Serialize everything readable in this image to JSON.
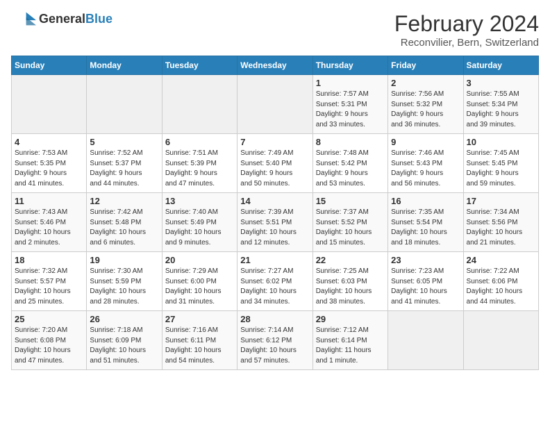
{
  "logo": {
    "general": "General",
    "blue": "Blue"
  },
  "header": {
    "month": "February 2024",
    "location": "Reconvilier, Bern, Switzerland"
  },
  "weekdays": [
    "Sunday",
    "Monday",
    "Tuesday",
    "Wednesday",
    "Thursday",
    "Friday",
    "Saturday"
  ],
  "weeks": [
    [
      {
        "day": "",
        "info": ""
      },
      {
        "day": "",
        "info": ""
      },
      {
        "day": "",
        "info": ""
      },
      {
        "day": "",
        "info": ""
      },
      {
        "day": "1",
        "info": "Sunrise: 7:57 AM\nSunset: 5:31 PM\nDaylight: 9 hours\nand 33 minutes."
      },
      {
        "day": "2",
        "info": "Sunrise: 7:56 AM\nSunset: 5:32 PM\nDaylight: 9 hours\nand 36 minutes."
      },
      {
        "day": "3",
        "info": "Sunrise: 7:55 AM\nSunset: 5:34 PM\nDaylight: 9 hours\nand 39 minutes."
      }
    ],
    [
      {
        "day": "4",
        "info": "Sunrise: 7:53 AM\nSunset: 5:35 PM\nDaylight: 9 hours\nand 41 minutes."
      },
      {
        "day": "5",
        "info": "Sunrise: 7:52 AM\nSunset: 5:37 PM\nDaylight: 9 hours\nand 44 minutes."
      },
      {
        "day": "6",
        "info": "Sunrise: 7:51 AM\nSunset: 5:39 PM\nDaylight: 9 hours\nand 47 minutes."
      },
      {
        "day": "7",
        "info": "Sunrise: 7:49 AM\nSunset: 5:40 PM\nDaylight: 9 hours\nand 50 minutes."
      },
      {
        "day": "8",
        "info": "Sunrise: 7:48 AM\nSunset: 5:42 PM\nDaylight: 9 hours\nand 53 minutes."
      },
      {
        "day": "9",
        "info": "Sunrise: 7:46 AM\nSunset: 5:43 PM\nDaylight: 9 hours\nand 56 minutes."
      },
      {
        "day": "10",
        "info": "Sunrise: 7:45 AM\nSunset: 5:45 PM\nDaylight: 9 hours\nand 59 minutes."
      }
    ],
    [
      {
        "day": "11",
        "info": "Sunrise: 7:43 AM\nSunset: 5:46 PM\nDaylight: 10 hours\nand 2 minutes."
      },
      {
        "day": "12",
        "info": "Sunrise: 7:42 AM\nSunset: 5:48 PM\nDaylight: 10 hours\nand 6 minutes."
      },
      {
        "day": "13",
        "info": "Sunrise: 7:40 AM\nSunset: 5:49 PM\nDaylight: 10 hours\nand 9 minutes."
      },
      {
        "day": "14",
        "info": "Sunrise: 7:39 AM\nSunset: 5:51 PM\nDaylight: 10 hours\nand 12 minutes."
      },
      {
        "day": "15",
        "info": "Sunrise: 7:37 AM\nSunset: 5:52 PM\nDaylight: 10 hours\nand 15 minutes."
      },
      {
        "day": "16",
        "info": "Sunrise: 7:35 AM\nSunset: 5:54 PM\nDaylight: 10 hours\nand 18 minutes."
      },
      {
        "day": "17",
        "info": "Sunrise: 7:34 AM\nSunset: 5:56 PM\nDaylight: 10 hours\nand 21 minutes."
      }
    ],
    [
      {
        "day": "18",
        "info": "Sunrise: 7:32 AM\nSunset: 5:57 PM\nDaylight: 10 hours\nand 25 minutes."
      },
      {
        "day": "19",
        "info": "Sunrise: 7:30 AM\nSunset: 5:59 PM\nDaylight: 10 hours\nand 28 minutes."
      },
      {
        "day": "20",
        "info": "Sunrise: 7:29 AM\nSunset: 6:00 PM\nDaylight: 10 hours\nand 31 minutes."
      },
      {
        "day": "21",
        "info": "Sunrise: 7:27 AM\nSunset: 6:02 PM\nDaylight: 10 hours\nand 34 minutes."
      },
      {
        "day": "22",
        "info": "Sunrise: 7:25 AM\nSunset: 6:03 PM\nDaylight: 10 hours\nand 38 minutes."
      },
      {
        "day": "23",
        "info": "Sunrise: 7:23 AM\nSunset: 6:05 PM\nDaylight: 10 hours\nand 41 minutes."
      },
      {
        "day": "24",
        "info": "Sunrise: 7:22 AM\nSunset: 6:06 PM\nDaylight: 10 hours\nand 44 minutes."
      }
    ],
    [
      {
        "day": "25",
        "info": "Sunrise: 7:20 AM\nSunset: 6:08 PM\nDaylight: 10 hours\nand 47 minutes."
      },
      {
        "day": "26",
        "info": "Sunrise: 7:18 AM\nSunset: 6:09 PM\nDaylight: 10 hours\nand 51 minutes."
      },
      {
        "day": "27",
        "info": "Sunrise: 7:16 AM\nSunset: 6:11 PM\nDaylight: 10 hours\nand 54 minutes."
      },
      {
        "day": "28",
        "info": "Sunrise: 7:14 AM\nSunset: 6:12 PM\nDaylight: 10 hours\nand 57 minutes."
      },
      {
        "day": "29",
        "info": "Sunrise: 7:12 AM\nSunset: 6:14 PM\nDaylight: 11 hours\nand 1 minute."
      },
      {
        "day": "",
        "info": ""
      },
      {
        "day": "",
        "info": ""
      }
    ]
  ]
}
